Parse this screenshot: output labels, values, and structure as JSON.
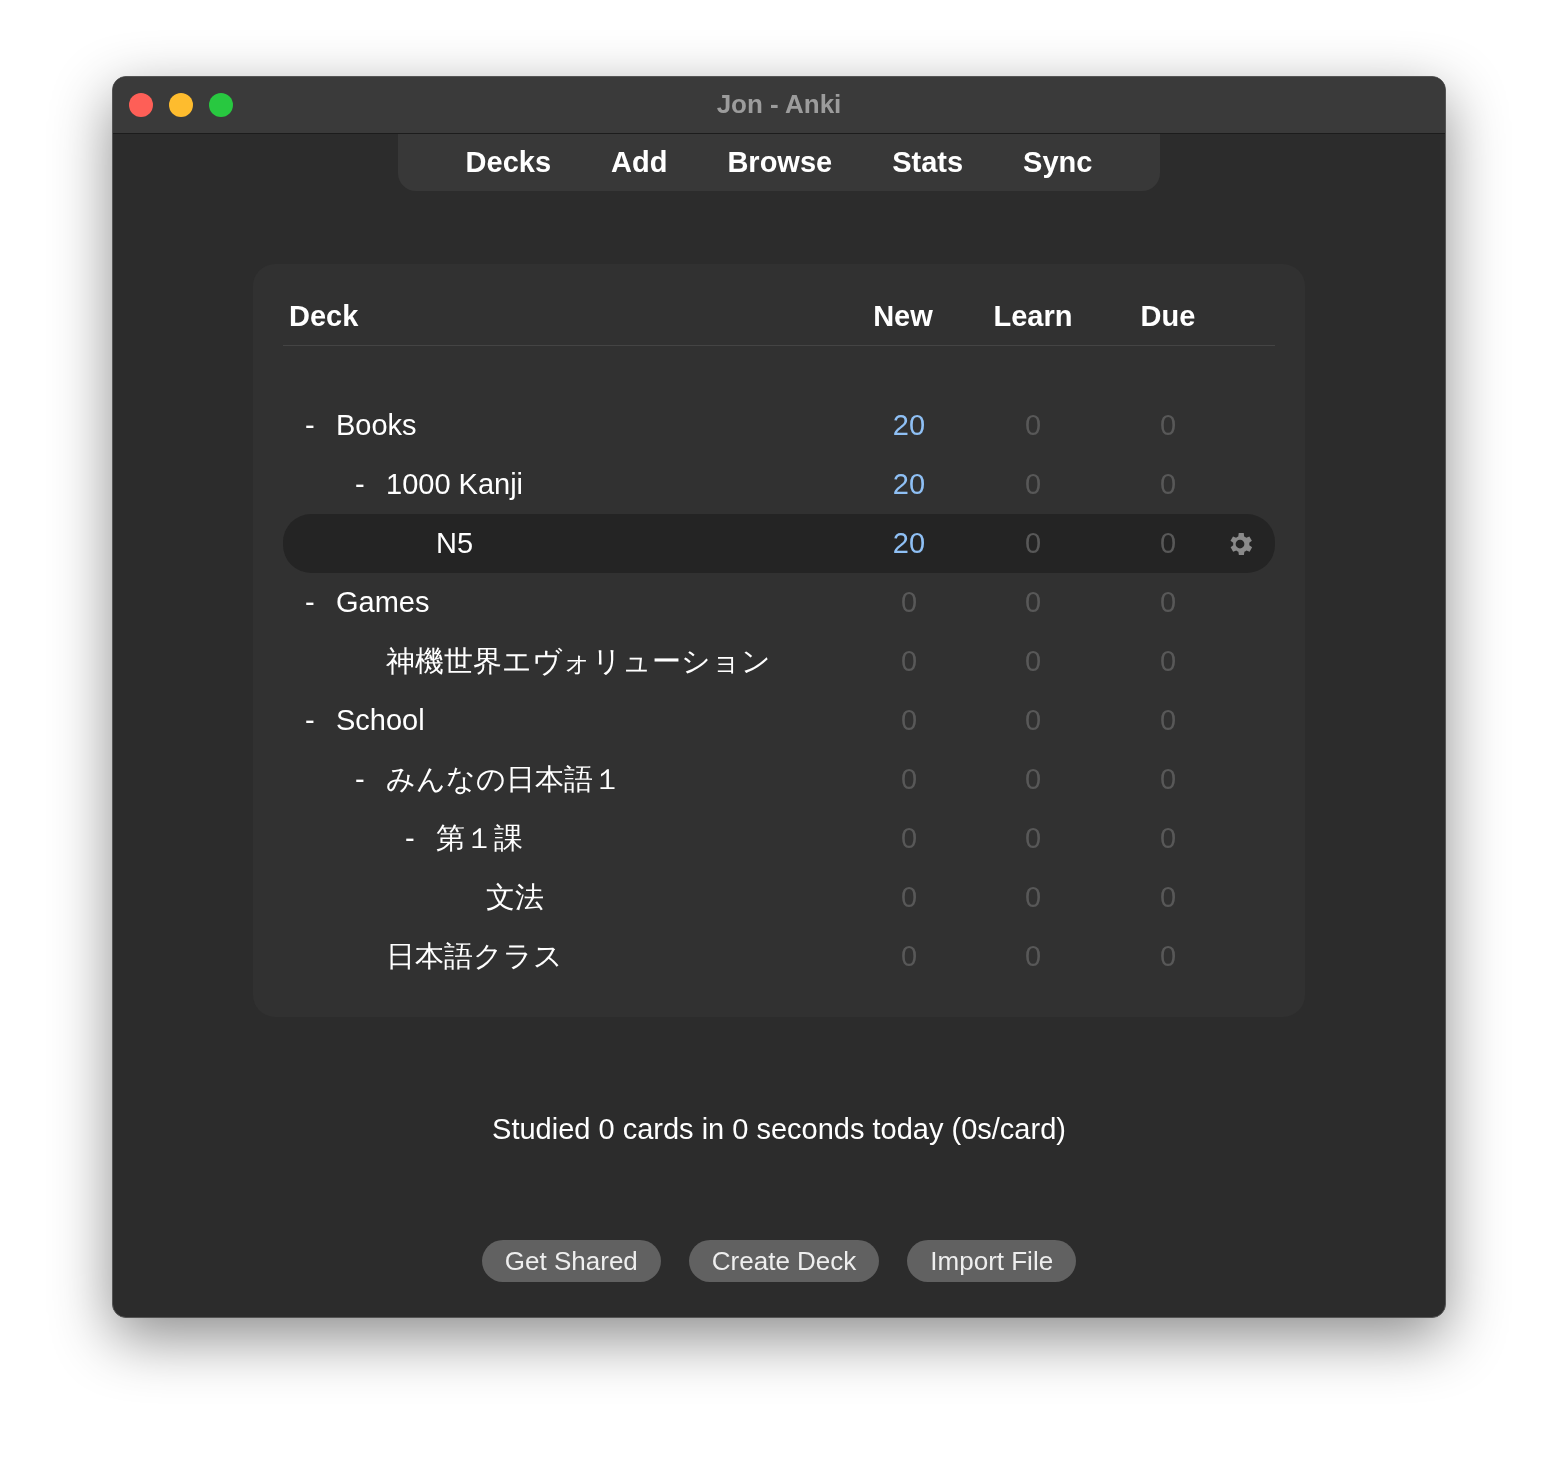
{
  "window": {
    "title": "Jon - Anki"
  },
  "toolbar": [
    {
      "label": "Decks"
    },
    {
      "label": "Add"
    },
    {
      "label": "Browse"
    },
    {
      "label": "Stats"
    },
    {
      "label": "Sync"
    }
  ],
  "deck_table": {
    "columns": [
      "Deck",
      "New",
      "Learn",
      "Due"
    ],
    "rows": [
      {
        "name": "Books",
        "toggle": "-",
        "selected": false,
        "counts": [
          {
            "value": "20",
            "highlight": true
          },
          {
            "value": "0",
            "highlight": false
          },
          {
            "value": "0",
            "highlight": false
          }
        ],
        "children": [
          {
            "name": "1000 Kanji",
            "toggle": "-",
            "selected": false,
            "counts": [
              {
                "value": "20",
                "highlight": true
              },
              {
                "value": "0",
                "highlight": false
              },
              {
                "value": "0",
                "highlight": false
              }
            ],
            "children": [
              {
                "name": "N5",
                "selected": true,
                "counts": [
                  {
                    "value": "20",
                    "highlight": true
                  },
                  {
                    "value": "0",
                    "highlight": false
                  },
                  {
                    "value": "0",
                    "highlight": false
                  }
                ]
              }
            ]
          }
        ]
      },
      {
        "name": "Games",
        "toggle": "-",
        "selected": false,
        "counts": [
          {
            "value": "0",
            "highlight": false
          },
          {
            "value": "0",
            "highlight": false
          },
          {
            "value": "0",
            "highlight": false
          }
        ],
        "children": [
          {
            "name": "神機世界エヴォリューション",
            "selected": false,
            "counts": [
              {
                "value": "0",
                "highlight": false
              },
              {
                "value": "0",
                "highlight": false
              },
              {
                "value": "0",
                "highlight": false
              }
            ]
          }
        ]
      },
      {
        "name": "School",
        "toggle": "-",
        "selected": false,
        "counts": [
          {
            "value": "0",
            "highlight": false
          },
          {
            "value": "0",
            "highlight": false
          },
          {
            "value": "0",
            "highlight": false
          }
        ],
        "children": [
          {
            "name": "みんなの日本語１",
            "toggle": "-",
            "selected": false,
            "counts": [
              {
                "value": "0",
                "highlight": false
              },
              {
                "value": "0",
                "highlight": false
              },
              {
                "value": "0",
                "highlight": false
              }
            ],
            "children": [
              {
                "name": "第１課",
                "toggle": "-",
                "selected": false,
                "counts": [
                  {
                    "value": "0",
                    "highlight": false
                  },
                  {
                    "value": "0",
                    "highlight": false
                  },
                  {
                    "value": "0",
                    "highlight": false
                  }
                ],
                "children": [
                  {
                    "name": "文法",
                    "selected": false,
                    "counts": [
                      {
                        "value": "0",
                        "highlight": false
                      },
                      {
                        "value": "0",
                        "highlight": false
                      },
                      {
                        "value": "0",
                        "highlight": false
                      }
                    ]
                  }
                ]
              }
            ]
          },
          {
            "name": "日本語クラス",
            "selected": false,
            "counts": [
              {
                "value": "0",
                "highlight": false
              },
              {
                "value": "0",
                "highlight": false
              },
              {
                "value": "0",
                "highlight": false
              }
            ]
          }
        ]
      }
    ]
  },
  "studied_text": "Studied 0 cards in 0 seconds today (0s/card)",
  "buttons": [
    {
      "label": "Get Shared"
    },
    {
      "label": "Create Deck"
    },
    {
      "label": "Import File"
    }
  ]
}
